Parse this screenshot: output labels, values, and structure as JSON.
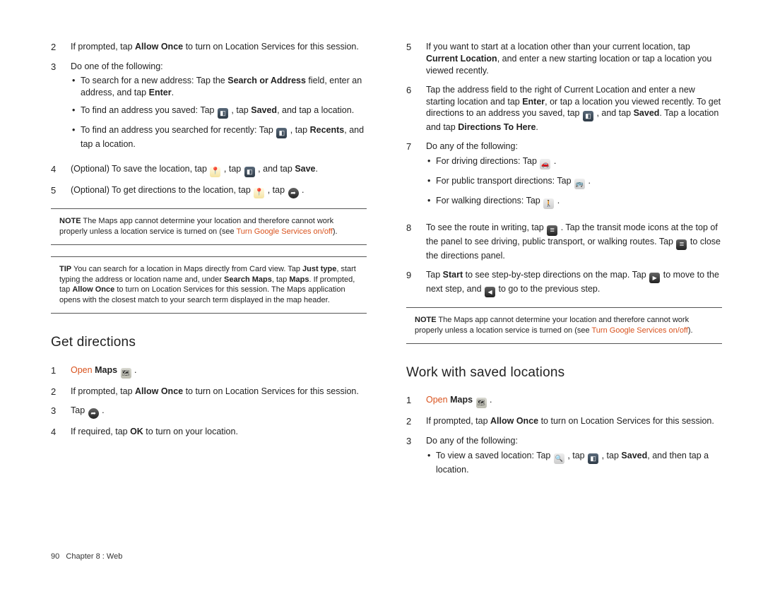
{
  "footer": {
    "page_num": "90",
    "chapter": "Chapter 8 : Web"
  },
  "left": {
    "steps_a": [
      {
        "n": "2",
        "html": "If prompted, tap <b>Allow Once</b> to turn on Location Services for this session."
      },
      {
        "n": "3",
        "html": "Do one of the following:",
        "bullets": [
          "To search for a new address: Tap the <b>Search or Address</b> field, enter an address, and tap <b>Enter</b>.",
          "To find an address you saved: Tap {book} , tap <b>Saved</b>, and tap a location.",
          "To find an address you searched for recently: Tap {book} , tap <b>Recents</b>, and tap a location."
        ]
      },
      {
        "n": "4",
        "html": "(Optional) To save the location, tap {pin} , tap {book} , and tap <b>Save</b>."
      },
      {
        "n": "5",
        "html": "(Optional) To get directions to the location, tap {pin} , tap {arrow} ."
      }
    ],
    "note1": {
      "label": "NOTE",
      "body": "The Maps app cannot determine your location and therefore cannot work properly unless a location service is turned on (see ",
      "link": "Turn Google Services on/off",
      "tail": ")."
    },
    "tip": {
      "label": "TIP",
      "body": "You can search for a location in Maps directly from Card view. Tap <b>Just type</b>, start typing the address or location name and, under <b>Search Maps</b>, tap <b>Maps</b>. If prompted, tap <b>Allow Once</b> to turn on Location Services for this session. The Maps application opens with the closest match to your search term displayed in the map header."
    },
    "heading": "Get directions",
    "steps_b": [
      {
        "n": "1",
        "html": "<span class='link'>Open</span> <b>Maps</b> {maps} ."
      },
      {
        "n": "2",
        "html": "If prompted, tap <b>Allow Once</b> to turn on Location Services for this session."
      },
      {
        "n": "3",
        "html": "Tap {arrow} ."
      },
      {
        "n": "4",
        "html": "If required, tap <b>OK</b> to turn on your location."
      }
    ]
  },
  "right": {
    "steps_a": [
      {
        "n": "5",
        "html": "If you want to start at a location other than your current location, tap <b>Current Location</b>, and enter a new starting location or tap a location you viewed recently."
      },
      {
        "n": "6",
        "html": "Tap the address field to the right of Current Location and enter a new starting location and tap <b>Enter</b>, or tap a location you viewed recently. To get directions to an address you saved, tap {book} , and tap <b>Saved</b>. Tap a location and tap <b>Directions To Here</b>."
      },
      {
        "n": "7",
        "html": "Do any of the following:",
        "bullets": [
          "For driving directions: Tap {car} .",
          "For public transport directions: Tap {bus} .",
          "For walking directions: Tap {walk} ."
        ]
      },
      {
        "n": "8",
        "html": "To see the route in writing, tap {list} . Tap the transit mode icons at the top of the panel to see driving, public transport, or walking routes. Tap {list} to close the directions panel."
      },
      {
        "n": "9",
        "html": "Tap <b>Start</b> to see step-by-step directions on the map. Tap {next} to move to the next step, and {prev} to go to the previous step."
      }
    ],
    "note1": {
      "label": "NOTE",
      "body": "The Maps app cannot determine your location and therefore cannot work properly unless a location service is turned on (see ",
      "link": "Turn Google Services on/off",
      "tail": ")."
    },
    "heading": "Work with saved locations",
    "steps_b": [
      {
        "n": "1",
        "html": "<span class='link'>Open</span> <b>Maps</b> {maps} ."
      },
      {
        "n": "2",
        "html": "If prompted, tap <b>Allow Once</b> to turn on Location Services for this session."
      },
      {
        "n": "3",
        "html": "Do any of the following:",
        "bullets": [
          "To view a saved location: Tap {search} , tap {book} , tap <b>Saved</b>, and then tap a location."
        ]
      }
    ]
  },
  "icons": {
    "pin": "pin-icon",
    "book": "book-icon",
    "arrow": "directions-arrow-icon",
    "maps": "maps-app-icon",
    "car": "car-icon",
    "bus": "bus-icon",
    "walk": "walk-icon",
    "list": "list-icon",
    "next": "next-arrow-icon",
    "prev": "prev-arrow-icon",
    "search": "search-icon"
  }
}
